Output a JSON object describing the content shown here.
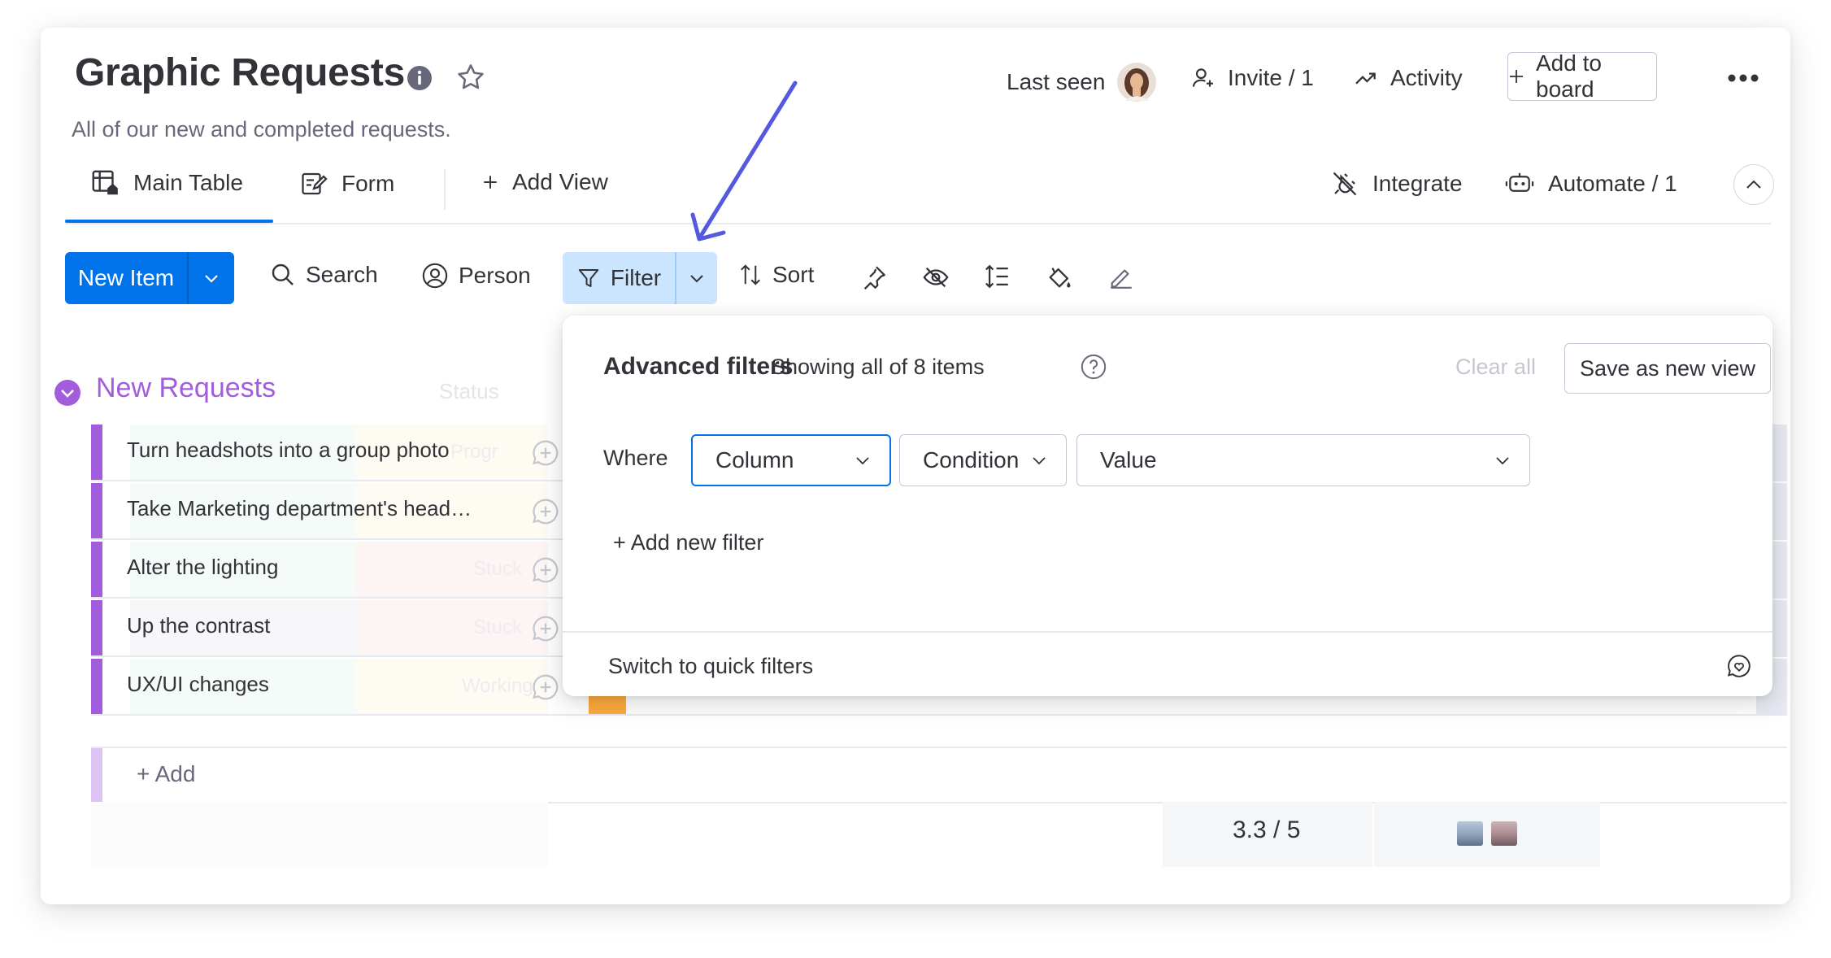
{
  "board": {
    "title": "Graphic Requests",
    "description": "All of our new and completed requests."
  },
  "header": {
    "last_seen": "Last seen",
    "invite": "Invite / 1",
    "activity": "Activity",
    "add_to_board": "Add to board"
  },
  "tabs": {
    "main_table": "Main Table",
    "form": "Form",
    "add_view": "Add View",
    "integrate": "Integrate",
    "automate": "Automate / 1"
  },
  "toolbar": {
    "new_item": "New Item",
    "search": "Search",
    "person": "Person",
    "filter": "Filter",
    "sort": "Sort"
  },
  "group": {
    "title": "New Requests",
    "status_header": "Status",
    "color": "#a25ddc",
    "items": [
      {
        "name": "Turn headshots into a group photo",
        "status_ghost": "Progr",
        "color": "#0086c0"
      },
      {
        "name": "Take Marketing department's head…",
        "status_ghost": "",
        "color": "#fdab3d"
      },
      {
        "name": "Alter the lighting",
        "status_ghost": "Stuck",
        "color": "#e2445c"
      },
      {
        "name": "Up the contrast",
        "status_ghost": "Stuck",
        "color": "#e2445c"
      },
      {
        "name": "UX/UI changes",
        "status_ghost": "Working",
        "color": "#fdab3d"
      }
    ],
    "add_label": "+ Add",
    "rating_summary": "3.3 / 5"
  },
  "filter_panel": {
    "title": "Advanced filters",
    "subtitle": "Showing all of 8 items",
    "clear_all": "Clear all",
    "save_view": "Save as new view",
    "where": "Where",
    "column_placeholder": "Column",
    "condition_placeholder": "Condition",
    "value_placeholder": "Value",
    "add_filter": "+ Add new filter",
    "quick_filters": "Switch to quick filters"
  },
  "colors": {
    "primary": "#0073ea",
    "filter_active_bg": "#cce5ff",
    "annotation_arrow": "#5559df"
  }
}
